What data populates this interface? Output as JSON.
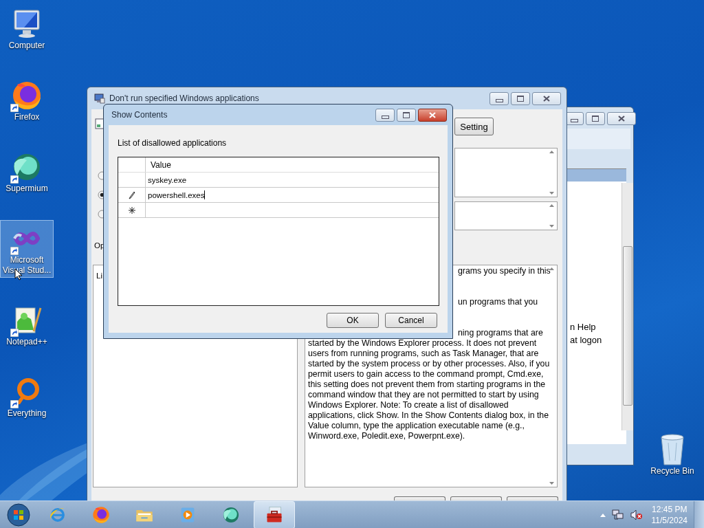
{
  "desktop_icons": [
    {
      "kind": "computer",
      "label": "Computer",
      "selected": false
    },
    {
      "kind": "firefox",
      "label": "Firefox",
      "selected": false
    },
    {
      "kind": "supermium",
      "label": "Supermium",
      "selected": false
    },
    {
      "kind": "visualstudio",
      "label": "Microsoft Visual Stud...",
      "selected": true
    },
    {
      "kind": "notepad",
      "label": "Notepad++",
      "selected": false
    },
    {
      "kind": "everything",
      "label": "Everything",
      "selected": false
    }
  ],
  "recycle_bin": {
    "label": "Recycle Bin"
  },
  "back_window": {
    "lines": [
      "n Help",
      "at logon"
    ]
  },
  "policy_window": {
    "title": "Don't run specified Windows applications",
    "setting_button": "Setting",
    "radios": [
      {
        "selected": false
      },
      {
        "selected": true
      },
      {
        "selected": false
      }
    ],
    "options_label": "Op",
    "options_text": "Li",
    "help_lines": [
      {
        "kind": "partial",
        "text": "grams you specify in this"
      },
      {
        "kind": "blank"
      },
      {
        "kind": "blank"
      },
      {
        "kind": "partial",
        "text": "un programs that you"
      },
      {
        "kind": "blank"
      },
      {
        "kind": "blank"
      },
      {
        "kind": "partial",
        "text": "ning programs that are"
      },
      {
        "kind": "full",
        "text": "started by the Windows Explorer process. It does not prevent"
      },
      {
        "kind": "full",
        "text": "users from running programs, such as Task Manager, that are"
      },
      {
        "kind": "full",
        "text": "started by the system process or by other processes. Also, if you"
      },
      {
        "kind": "full",
        "text": "permit users to gain access to the command prompt, Cmd.exe,"
      },
      {
        "kind": "full",
        "text": "this setting does not prevent them from starting programs in the"
      },
      {
        "kind": "full",
        "text": "command window that they are not permitted to start by using"
      },
      {
        "kind": "full",
        "text": "Windows Explorer. Note: To create a list of disallowed"
      },
      {
        "kind": "full",
        "text": "applications, click Show. In the Show Contents dialog box, in the"
      },
      {
        "kind": "full",
        "text": "Value column, type the application executable name (e.g.,"
      },
      {
        "kind": "full",
        "text": "Winword.exe, Poledit.exe, Powerpnt.exe)."
      }
    ]
  },
  "dialog": {
    "title": "Show Contents",
    "label": "List of disallowed applications",
    "column": "Value",
    "rows": [
      {
        "kind": "normal",
        "value": "syskey.exe"
      },
      {
        "kind": "editing",
        "value": "powershell.exes"
      },
      {
        "kind": "new"
      }
    ],
    "buttons": [
      "OK",
      "Cancel"
    ]
  },
  "taskbar": {
    "apps": [
      {
        "kind": "ie",
        "selected": false
      },
      {
        "kind": "firefox",
        "selected": false
      },
      {
        "kind": "explorer",
        "selected": false
      },
      {
        "kind": "media",
        "selected": false
      },
      {
        "kind": "supermium",
        "selected": false
      },
      {
        "kind": "toolbox",
        "selected": true
      }
    ],
    "time": "12:45 PM",
    "date": "11/5/2024"
  }
}
